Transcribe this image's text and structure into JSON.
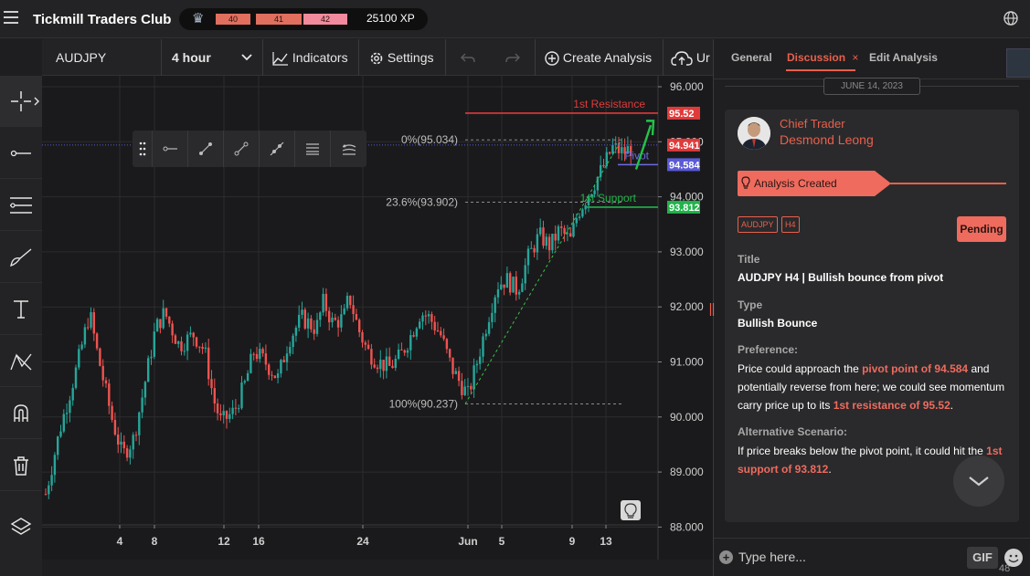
{
  "header": {
    "app_title": "Tickmill Traders Club",
    "xp_levels": [
      "40",
      "41",
      "42"
    ],
    "xp_value": "25100 XP"
  },
  "toolbar": {
    "symbol": "AUDJPY",
    "timeframe": "4 hour",
    "indicators_label": "Indicators",
    "settings_label": "Settings",
    "create_analysis_label": "Create Analysis",
    "upload_label": "Ur"
  },
  "chart": {
    "price_axis": [
      "96.000",
      "95.000",
      "94.000",
      "93.000",
      "92.000",
      "91.000",
      "90.000",
      "89.000",
      "88.000"
    ],
    "date_axis": [
      "4",
      "8",
      "12",
      "16",
      "24",
      "Jun",
      "5",
      "9",
      "13"
    ],
    "price_badges": {
      "resistance": "95.52",
      "current": "94.941",
      "pivot": "94.584",
      "support": "93.812"
    },
    "line_labels": {
      "resistance": "1st Resistance",
      "pivot": "Pivot",
      "support": "1st Support"
    },
    "fib_labels": {
      "top": "0%(95.034)",
      "mid": "23.6%(93.902)",
      "bottom": "100%(90.237)"
    },
    "colors": {
      "bull": "#26a69a",
      "bear": "#ef5350",
      "resistance": "#e03a3a",
      "pivot": "#6c6ce0",
      "support": "#22b34a"
    }
  },
  "panel": {
    "tabs": [
      "General",
      "Discussion",
      "Edit Analysis"
    ],
    "date": "JUNE 14, 2023",
    "author_role": "Chief Trader",
    "author_name": "Desmond Leong",
    "status": "Analysis Created",
    "tags": [
      "AUDJPY",
      "H4"
    ],
    "pending": "Pending",
    "title_label": "Title",
    "title_value": "AUDJPY H4 | Bullish bounce from pivot",
    "type_label": "Type",
    "type_value": "Bullish Bounce",
    "preference_label": "Preference:",
    "preference_text_1": "Price could approach the ",
    "preference_hl_1": "pivot point of 94.584",
    "preference_text_2": " and potentially reverse from here; we could see momentum carry price up to its ",
    "preference_hl_2": "1st resistance of 95.52",
    "preference_text_3": ".",
    "alt_label": "Alternative Scenario:",
    "alt_text_1": "If price breaks below the pivot point, it could hit the ",
    "alt_hl_1": "1st support of 93.812",
    "alt_text_2": ".",
    "time": "48",
    "composer_placeholder": "Type here...",
    "gif_label": "GIF"
  }
}
